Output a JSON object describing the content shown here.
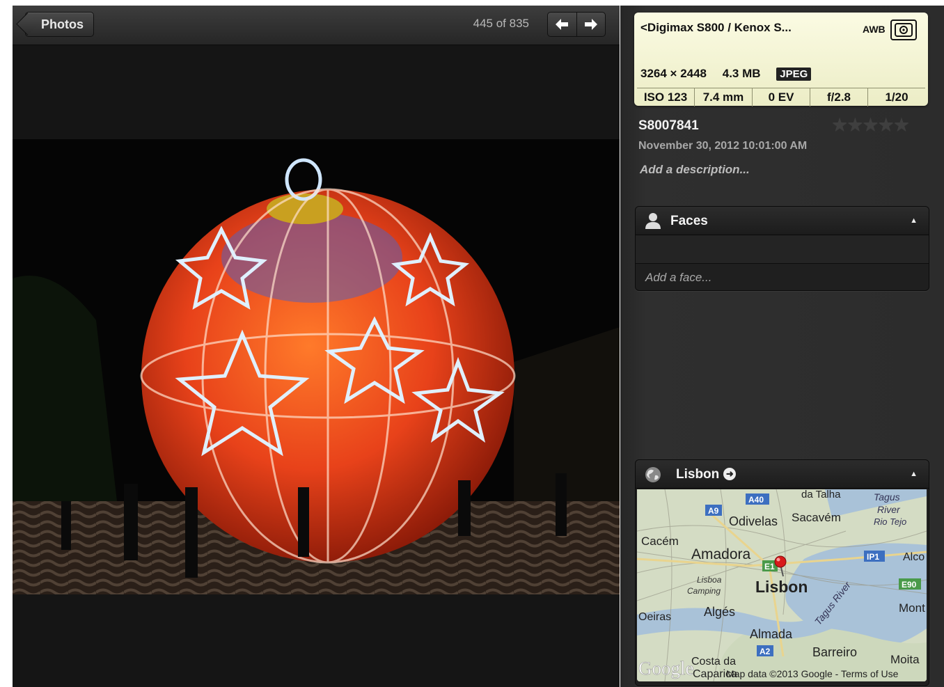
{
  "toolbar": {
    "back_label": "Photos",
    "counter": "445 of 835",
    "prev_icon": "arrow-left-icon",
    "next_icon": "arrow-right-icon"
  },
  "exif": {
    "camera": "<Digimax S800 / Kenox S...",
    "white_balance": "AWB",
    "metering_icon": "metering-icon",
    "dimensions": "3264 × 2448",
    "file_size": "4.3 MB",
    "format": "JPEG",
    "iso": "ISO 123",
    "focal_length": "7.4 mm",
    "exposure_bias": "0 EV",
    "aperture": "f/2.8",
    "shutter": "1/20"
  },
  "photo_info": {
    "title": "S8007841",
    "rating_stars": "★★★★★",
    "rating": 0,
    "date": "November 30, 2012 10:01:00 AM",
    "description_placeholder": "Add a description..."
  },
  "faces_panel": {
    "title": "Faces",
    "icon": "person-icon",
    "add_label": "Add a face..."
  },
  "location_panel": {
    "title": "Lisbon",
    "icon": "globe-icon",
    "map_labels": {
      "da_talha": "da Talha",
      "tagus_river": "Tagus",
      "tagus_river2": "River",
      "rio_tejo": "Rio Tejo",
      "a40": "A40",
      "a9": "A9",
      "odivelas": "Odivelas",
      "sacavem": "Sacavém",
      "cacem": "Cacém",
      "amadora": "Amadora",
      "ip1": "IP1",
      "alco": "Alco",
      "e1": "E1",
      "lisboa_camping": "Lisboa",
      "lisboa_camping2": "Camping",
      "lisbon": "Lisbon",
      "tagus_river_diag": "Tagus River",
      "e90": "E90",
      "oeiras": "Oeiras",
      "alges": "Algés",
      "mont": "Mont",
      "almada": "Almada",
      "a2": "A2",
      "barreiro": "Barreiro",
      "moita": "Moita",
      "costa_da": "Costa da",
      "caparica": "Caparica",
      "google": "Google",
      "attribution": "Map data ©2013 Google - Terms of Use"
    }
  }
}
